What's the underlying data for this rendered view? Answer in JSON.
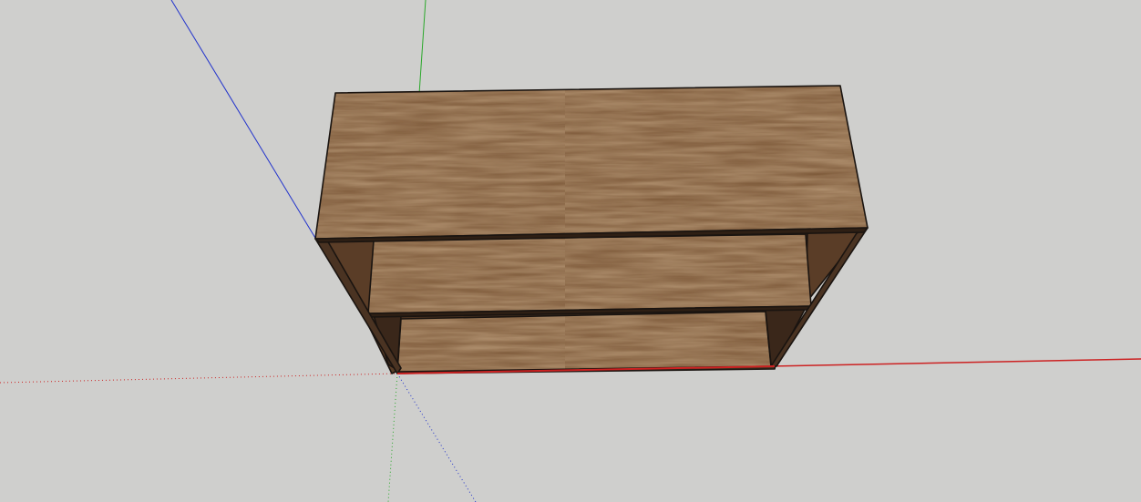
{
  "app": {
    "type": "3d-modeling-viewport",
    "background_color": "#cfcfcd"
  },
  "axes": {
    "red_color": "#cc2222",
    "green_color": "#2aa82a",
    "blue_color": "#2233cc"
  },
  "model": {
    "object": "bookshelf",
    "material": "wood",
    "wood_color": "#7a5636",
    "edge_color": "#1a1410",
    "shelf_count": 3
  }
}
